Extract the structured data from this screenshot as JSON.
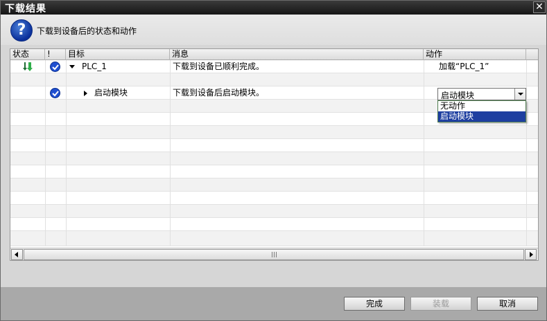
{
  "window": {
    "title": "下载结果",
    "close_glyph": "✕"
  },
  "header": {
    "text": "下载到设备后的状态和动作",
    "icon": "help-icon"
  },
  "table": {
    "columns": [
      "状态",
      "!",
      "目标",
      "消息",
      "动作"
    ],
    "rows": [
      {
        "target": "PLC_1",
        "message": "下载到设备已顺利完成。",
        "action": "加载“PLC_1”",
        "status_icon": "download-arrow-icon",
        "check": true,
        "expanded": true
      },
      {
        "target": "启动模块",
        "message": "下载到设备后启动模块。",
        "action": "启动模块",
        "check": true,
        "expanded": false
      }
    ]
  },
  "action_combo": {
    "value": "启动模块",
    "options": [
      "无动作",
      "启动模块"
    ],
    "selected_index": 1
  },
  "buttons": {
    "finish": "完成",
    "load": "装载",
    "cancel": "取消"
  },
  "colors": {
    "title_bar": "#1f1f1f",
    "check": "#1f4fd0",
    "selection": "#1e3fa0",
    "footer": "#a9a9a9"
  }
}
